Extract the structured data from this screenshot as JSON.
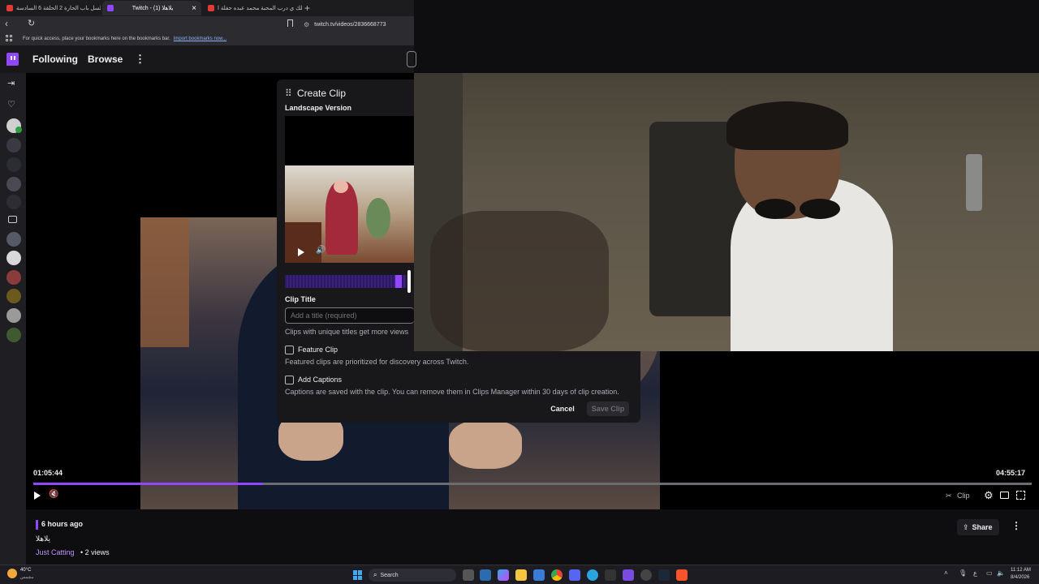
{
  "browser": {
    "tabs": [
      {
        "label": "مسلسل باب الحارة 2 الحلقة 6 السادسة",
        "color": "#e53935"
      },
      {
        "label": "Twitch - يلاهلا (1)",
        "color": "#9147ff"
      },
      {
        "label": "ويلك ي درب المحبة محمد عبده حفلة ا...",
        "color": "#e53935"
      }
    ],
    "close_glyph": "×",
    "new_tab_glyph": "+",
    "url": "twitch.tv/videos/2836668773",
    "bookmarks_hint": "For quick access, place your bookmarks here on the bookmarks bar.",
    "bookmarks_link": "Import bookmarks now..."
  },
  "nav": {
    "following": "Following",
    "browse": "Browse",
    "more_glyph": "⋮"
  },
  "clip": {
    "title": "Create Clip",
    "subtitle": "Landscape Version",
    "clip_title_label": "Clip Title",
    "title_placeholder": "Add a title (required)",
    "title_hint": "Clips with unique titles get more views",
    "feature_label": "Feature Clip",
    "feature_desc": "Featured clips are prioritized for discovery across Twitch.",
    "captions_label": "Add Captions",
    "captions_desc": "Captions are saved with the clip. You can remove them in Clips Manager within 30 days of clip creation.",
    "cancel": "Cancel",
    "save": "Save Clip"
  },
  "player": {
    "current_time": "01:05:44",
    "duration": "04:55:17",
    "progress_fraction": 0.23,
    "clip_label": "Clip"
  },
  "video_info": {
    "time_ago": "6 hours ago",
    "title": "يلاهلا",
    "category": "Just Catting",
    "views": " • 2 views",
    "share": "Share"
  },
  "taskbar": {
    "weather_temp": "40°C",
    "weather_desc": "مشمس",
    "search": "Search",
    "lang": "ع",
    "time": "11:12 AM",
    "date": "8/4/2026"
  },
  "colors": {
    "accent": "#9147ff",
    "bg": "#0e0e10",
    "panel": "#18181b"
  }
}
